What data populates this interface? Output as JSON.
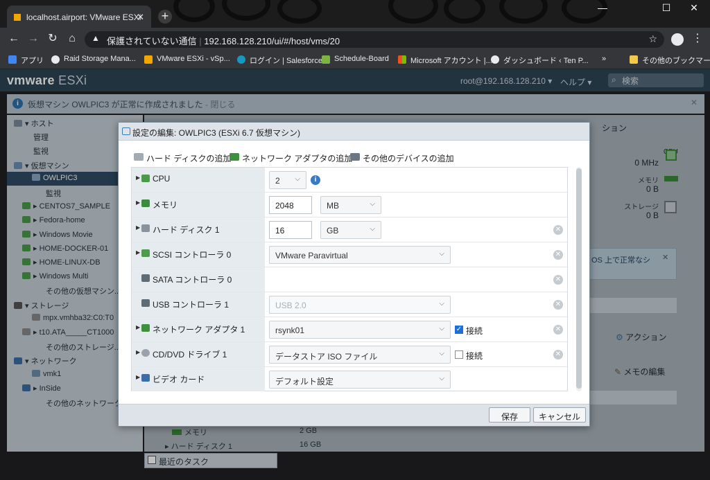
{
  "browser": {
    "tab_title": "localhost.airport: VMware ESXi",
    "tab_close": "✕",
    "new_tab": "+",
    "security_label": "保護されていない通信",
    "url": "192.168.128.210/ui/#/host/vms/20",
    "bookmarks": [
      {
        "label": "アプリ",
        "color": "#4285f4"
      },
      {
        "label": "Raid Storage Mana...",
        "color": "#e8eaed"
      },
      {
        "label": "VMware ESXi - vSp...",
        "color": "#f0a800"
      },
      {
        "label": "ログイン | Salesforce",
        "color": "#1798c1"
      },
      {
        "label": "Schedule-Board",
        "color": "#7cb342"
      },
      {
        "label": "Microsoft アカウント |...",
        "color": "#f25022"
      },
      {
        "label": "ダッシュボード ‹ Ten P...",
        "color": "#e8eaed"
      }
    ],
    "bookmark_more": "»",
    "other_bookmarks": "その他のブックマーク"
  },
  "esxi": {
    "logo_main": "vmware",
    "logo_sub": " ESXi",
    "user": "root@192.168.128.210 ▾",
    "help": "ヘルプ ▾",
    "search_placeholder": "検索",
    "banner_text": "仮想マシン OWLPIC3 が正常に作成されました",
    "banner_close": "閉じる",
    "banner_info": "i",
    "banner_x": "✕",
    "bottom_tasks": "最近のタスク"
  },
  "navigator": [
    {
      "label": "▾ ホスト",
      "indent": 10,
      "icon": "#7a8a99"
    },
    {
      "label": "管理",
      "indent": 38,
      "icon": ""
    },
    {
      "label": "監視",
      "indent": 38,
      "icon": ""
    },
    {
      "label": "▾ 仮想マシン",
      "indent": 10,
      "icon": "#6a8fb2"
    },
    {
      "label": "OWLPIC3",
      "indent": 36,
      "icon": "#88a7c4",
      "selected": true
    },
    {
      "label": "監視",
      "indent": 56,
      "icon": ""
    },
    {
      "label": "▸ CENTOS7_SAMPLE",
      "indent": 22,
      "icon": "#4a9a4a"
    },
    {
      "label": "▸ Fedora-home",
      "indent": 22,
      "icon": "#4a9a4a"
    },
    {
      "label": "▸ Windows Movie",
      "indent": 22,
      "icon": "#4a9a4a"
    },
    {
      "label": "▸ HOME-DOCKER-01",
      "indent": 22,
      "icon": "#4a9a4a"
    },
    {
      "label": "▸ HOME-LINUX-DB",
      "indent": 22,
      "icon": "#4a9a4a"
    },
    {
      "label": "▸ Windows Multi",
      "indent": 22,
      "icon": "#4a9a4a"
    },
    {
      "label": "その他の仮想マシン...",
      "indent": 56,
      "icon": ""
    },
    {
      "label": "▾ ストレージ",
      "indent": 10,
      "icon": "#555"
    },
    {
      "label": "mpx.vmhba32:C0:T0",
      "indent": 36,
      "icon": "#888"
    },
    {
      "label": "▸ t10.ATA_____CT1000",
      "indent": 22,
      "icon": "#888"
    },
    {
      "label": "その他のストレージ...",
      "indent": 56,
      "icon": ""
    },
    {
      "label": "▾ ネットワーク",
      "indent": 10,
      "icon": "#3b6ea5"
    },
    {
      "label": "vmk1",
      "indent": 36,
      "icon": "#6f8da8"
    },
    {
      "label": "▸ InSide",
      "indent": 22,
      "icon": "#3b6ea5"
    },
    {
      "label": "その他のネットワーク...",
      "indent": 56,
      "icon": ""
    }
  ],
  "background": {
    "section_fragment": "ション",
    "cpu_label": "CPU",
    "cpu_value": "0 MHz",
    "mem_label": "メモリ",
    "mem_value": "0 B",
    "storage_label": "ストレージ",
    "storage_value": "0 B",
    "notice_fragment": "OS 上で正常なシ",
    "notice_close": "✕",
    "action_label": "アクション",
    "memo_label": "メモの編集",
    "row1_label": "メモリ",
    "row1_value": "2 GB",
    "row2_label": "▸ ハード ディスク 1",
    "row2_value": "16 GB"
  },
  "modal": {
    "title": "設定の編集: OWLPIC3 (ESXi 6.7 仮想マシン)",
    "add_buttons": [
      "ハード ディスクの追加",
      "ネットワーク アダプタの追加",
      "その他のデバイスの追加"
    ],
    "save": "保存",
    "cancel": "キャンセル",
    "remove_glyph": "✕",
    "check_glyph": "✓",
    "rows": [
      {
        "label": "CPU",
        "expandable": true,
        "icon_color": "#4b9a4b"
      },
      {
        "label": "メモリ",
        "expandable": true,
        "icon_color": "#3d8c3d"
      },
      {
        "label": "ハード ディスク 1",
        "expandable": true,
        "icon_color": "#8a939b"
      },
      {
        "label": "SCSI コントローラ 0",
        "expandable": true,
        "icon_color": "#4e9a4e"
      },
      {
        "label": "SATA コントローラ 0",
        "expandable": false,
        "icon_color": "#5f6b75"
      },
      {
        "label": "USB コントローラ 1",
        "expandable": false,
        "icon_color": "#5f6b75"
      },
      {
        "label": "ネットワーク アダプタ 1",
        "expandable": true,
        "icon_color": "#3f8f3f"
      },
      {
        "label": "CD/DVD ドライブ 1",
        "expandable": true,
        "icon_color": "#9aa3ab"
      },
      {
        "label": "ビデオ カード",
        "expandable": true,
        "icon_color": "#3b6ea5"
      }
    ],
    "cpu_value": "2",
    "mem_value": "2048",
    "mem_unit": "MB",
    "disk_value": "16",
    "disk_unit": "GB",
    "scsi_type": "VMware Paravirtual",
    "usb_type": "USB 2.0",
    "net_value": "rsynk01",
    "net_connect_label": "接続",
    "net_connected": true,
    "cd_value": "データストア ISO ファイル",
    "cd_connect_label": "接続",
    "cd_connected": false,
    "video_value": "デフォルト設定"
  }
}
